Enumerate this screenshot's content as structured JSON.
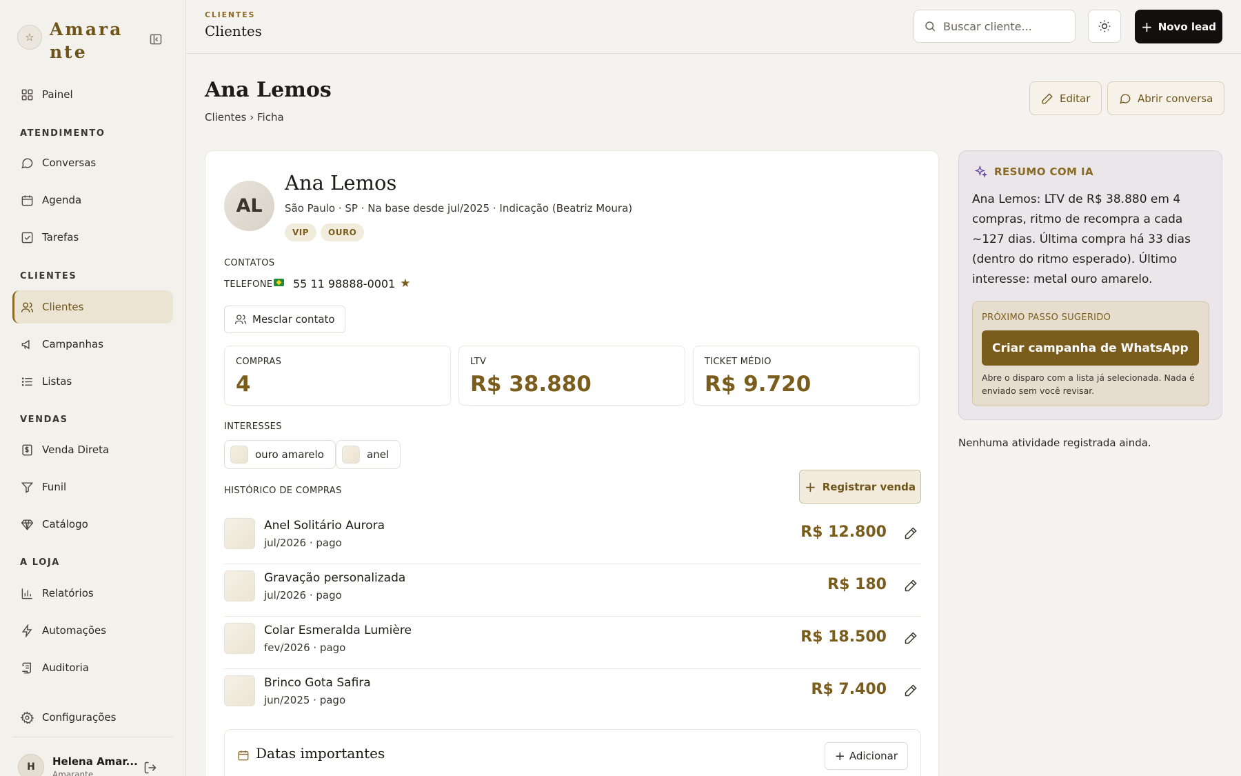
{
  "brand": {
    "name": "Amarante"
  },
  "sidebar": {
    "painel": "Painel",
    "sections": {
      "atendimento": "ATENDIMENTO",
      "clientes": "CLIENTES",
      "vendas": "VENDAS",
      "loja": "A LOJA"
    },
    "items": {
      "conversas": "Conversas",
      "agenda": "Agenda",
      "tarefas": "Tarefas",
      "clientes": "Clientes",
      "campanhas": "Campanhas",
      "listas": "Listas",
      "venda_direta": "Venda Direta",
      "funil": "Funil",
      "catalogo": "Catálogo",
      "relatorios": "Relatórios",
      "automacoes": "Automações",
      "auditoria": "Auditoria",
      "configuracoes": "Configurações"
    },
    "user": {
      "initial": "H",
      "name": "Helena Amar...",
      "sub": "Amarante"
    }
  },
  "topbar": {
    "section_label": "CLIENTES",
    "title": "Clientes",
    "search_placeholder": "Buscar cliente...",
    "new_lead_label": "Novo lead"
  },
  "page": {
    "title": "Ana Lemos",
    "breadcrumb": "Clientes › Ficha",
    "edit_label": "Editar",
    "open_chat_label": "Abrir conversa"
  },
  "client": {
    "initials": "AL",
    "name": "Ana Lemos",
    "meta": "São Paulo · SP · Na base desde jul/2025 · Indicação (Beatriz Moura)",
    "tags": [
      "VIP",
      "OURO"
    ],
    "contacts_label": "CONTATOS",
    "phone_label": "TELEFONE",
    "phone": "55 11 98888-0001",
    "merge_label": "Mesclar contato",
    "stats": [
      {
        "label": "COMPRAS",
        "value": "4"
      },
      {
        "label": "LTV",
        "value": "R$ 38.880"
      },
      {
        "label": "TICKET MÉDIO",
        "value": "R$ 9.720"
      }
    ],
    "interests_label": "INTERESSES",
    "interests": [
      "ouro amarelo",
      "anel"
    ],
    "history_label": "HISTÓRICO DE COMPRAS",
    "register_sale_label": "Registrar venda",
    "purchases": [
      {
        "name": "Anel Solitário Aurora",
        "sub": "jul/2026 · pago",
        "price": "R$ 12.800"
      },
      {
        "name": "Gravação personalizada",
        "sub": "jul/2026 · pago",
        "price": "R$ 180"
      },
      {
        "name": "Colar Esmeralda Lumière",
        "sub": "fev/2026 · pago",
        "price": "R$ 18.500"
      },
      {
        "name": "Brinco Gota Safira",
        "sub": "jun/2025 · pago",
        "price": "R$ 7.400"
      }
    ],
    "dates_title": "Datas importantes",
    "add_label": "Adicionar"
  },
  "ai": {
    "title": "RESUMO COM IA",
    "summary": "Ana Lemos: LTV de R$ 38.880 em 4 compras, ritmo de recompra a cada ~127 dias. Última compra há 33 dias (dentro do ritmo esperado). Último interesse: metal ouro amarelo.",
    "next_label": "PRÓXIMO PASSO SUGERIDO",
    "cta_label": "Criar campanha de WhatsApp",
    "note": "Abre o disparo com a lista já selecionada. Nada é enviado sem você revisar."
  },
  "activity": {
    "empty": "Nenhuma atividade registrada ainda."
  }
}
